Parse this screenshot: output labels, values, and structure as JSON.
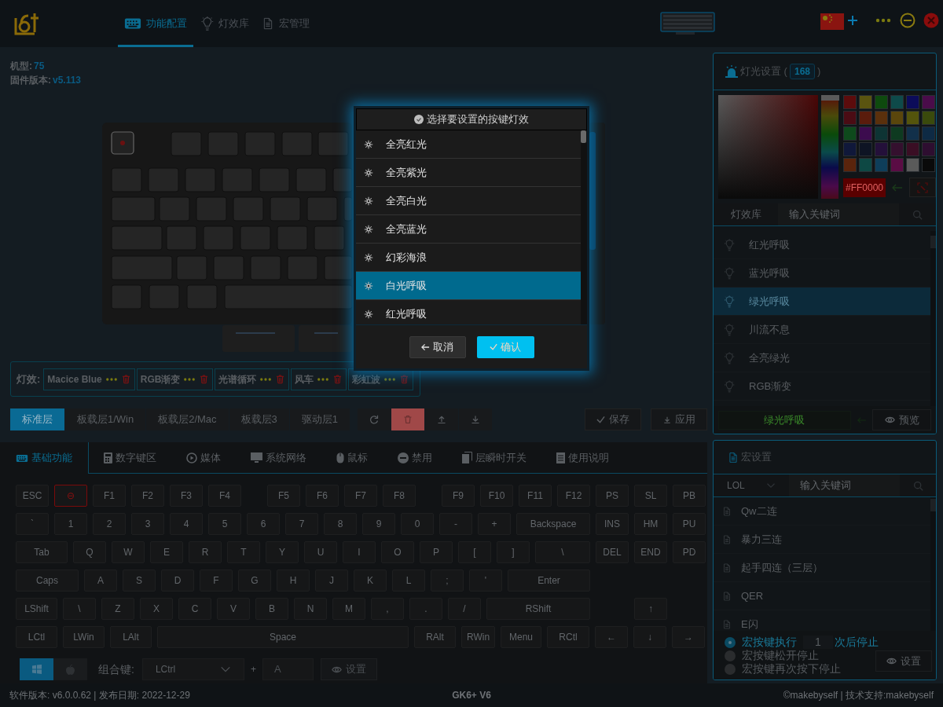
{
  "nav_tabs": [
    {
      "label": "功能配置",
      "selected": true
    },
    {
      "label": "灯效库",
      "selected": false
    },
    {
      "label": "宏管理",
      "selected": false
    }
  ],
  "device_info": [
    {
      "label": "机型:",
      "value": "75"
    },
    {
      "label": "固件版本:",
      "value": "v5.113"
    }
  ],
  "effects_bar": {
    "label": "灯效:",
    "effects": [
      "Macice Blue",
      "RGB渐变",
      "光谱循环",
      "风车",
      "彩虹波"
    ]
  },
  "layers": [
    {
      "label": "标准层",
      "selected": true
    },
    {
      "label": "板载层1/Win",
      "selected": false
    },
    {
      "label": "板载层2/Mac",
      "selected": false
    },
    {
      "label": "板载层3",
      "selected": false
    },
    {
      "label": "驱动层1",
      "selected": false
    }
  ],
  "save_button": "保存",
  "apply_button": "应用",
  "key_tabs": [
    {
      "label": "基础功能",
      "selected": true
    },
    {
      "label": "数字键区",
      "selected": false
    },
    {
      "label": "媒体",
      "selected": false
    },
    {
      "label": "系统网络",
      "selected": false
    },
    {
      "label": "鼠标",
      "selected": false
    },
    {
      "label": "禁用",
      "selected": false
    },
    {
      "label": "层瞬时开关",
      "selected": false
    },
    {
      "label": "使用说明",
      "selected": false
    }
  ],
  "keys": [
    [
      {
        "label": "ESC",
        "selected": false
      },
      {
        "label": "⊖",
        "selected": true
      },
      {
        "label": "F1",
        "selected": false
      },
      {
        "label": "F2",
        "selected": false
      },
      {
        "label": "F3",
        "selected": false
      },
      {
        "label": "F4",
        "selected": false
      },
      {
        "label": "F5",
        "selected": false
      },
      {
        "label": "F6",
        "selected": false
      },
      {
        "label": "F7",
        "selected": false
      },
      {
        "label": "F8",
        "selected": false
      },
      {
        "label": "F9",
        "selected": false
      },
      {
        "label": "F10",
        "selected": false
      },
      {
        "label": "F11",
        "selected": false
      },
      {
        "label": "F12",
        "selected": false
      },
      {
        "label": "PS",
        "selected": false
      },
      {
        "label": "SL",
        "selected": false
      },
      {
        "label": "PB",
        "selected": false
      }
    ],
    [
      {
        "label": "`",
        "selected": false
      },
      {
        "label": "1",
        "selected": false
      },
      {
        "label": "2",
        "selected": false
      },
      {
        "label": "3",
        "selected": false
      },
      {
        "label": "4",
        "selected": false
      },
      {
        "label": "5",
        "selected": false
      },
      {
        "label": "6",
        "selected": false
      },
      {
        "label": "7",
        "selected": false
      },
      {
        "label": "8",
        "selected": false
      },
      {
        "label": "9",
        "selected": false
      },
      {
        "label": "0",
        "selected": false
      },
      {
        "label": "-",
        "selected": false
      },
      {
        "label": "+",
        "selected": false
      },
      {
        "label": "Backspace",
        "selected": false
      },
      {
        "label": "INS",
        "selected": false
      },
      {
        "label": "HM",
        "selected": false
      },
      {
        "label": "PU",
        "selected": false
      }
    ],
    [
      {
        "label": "Tab",
        "selected": false
      },
      {
        "label": "Q",
        "selected": false
      },
      {
        "label": "W",
        "selected": false
      },
      {
        "label": "E",
        "selected": false
      },
      {
        "label": "R",
        "selected": false
      },
      {
        "label": "T",
        "selected": false
      },
      {
        "label": "Y",
        "selected": false
      },
      {
        "label": "U",
        "selected": false
      },
      {
        "label": "I",
        "selected": false
      },
      {
        "label": "O",
        "selected": false
      },
      {
        "label": "P",
        "selected": false
      },
      {
        "label": "[",
        "selected": false
      },
      {
        "label": "]",
        "selected": false
      },
      {
        "label": "\\",
        "selected": false
      },
      {
        "label": "DEL",
        "selected": false
      },
      {
        "label": "END",
        "selected": false
      },
      {
        "label": "PD",
        "selected": false
      }
    ],
    [
      {
        "label": "Caps",
        "selected": false
      },
      {
        "label": "A",
        "selected": false
      },
      {
        "label": "S",
        "selected": false
      },
      {
        "label": "D",
        "selected": false
      },
      {
        "label": "F",
        "selected": false
      },
      {
        "label": "G",
        "selected": false
      },
      {
        "label": "H",
        "selected": false
      },
      {
        "label": "J",
        "selected": false
      },
      {
        "label": "K",
        "selected": false
      },
      {
        "label": "L",
        "selected": false
      },
      {
        "label": ";",
        "selected": false
      },
      {
        "label": "'",
        "selected": false
      },
      {
        "label": "Enter",
        "selected": false
      }
    ],
    [
      {
        "label": "LShift",
        "selected": false
      },
      {
        "label": "\\",
        "selected": false
      },
      {
        "label": "Z",
        "selected": false
      },
      {
        "label": "X",
        "selected": false
      },
      {
        "label": "C",
        "selected": false
      },
      {
        "label": "V",
        "selected": false
      },
      {
        "label": "B",
        "selected": false
      },
      {
        "label": "N",
        "selected": false
      },
      {
        "label": "M",
        "selected": false
      },
      {
        "label": ",",
        "selected": false
      },
      {
        "label": ".",
        "selected": false
      },
      {
        "label": "/",
        "selected": false
      },
      {
        "label": "RShift",
        "selected": false
      },
      {
        "label": "↑",
        "selected": false
      }
    ],
    [
      {
        "label": "LCtl",
        "selected": false
      },
      {
        "label": "LWin",
        "selected": false
      },
      {
        "label": "LAlt",
        "selected": false
      },
      {
        "label": "Space",
        "selected": false
      },
      {
        "label": "RAlt",
        "selected": false
      },
      {
        "label": "RWin",
        "selected": false
      },
      {
        "label": "Menu",
        "selected": false
      },
      {
        "label": "RCtl",
        "selected": false
      },
      {
        "label": "←",
        "selected": false
      },
      {
        "label": "↓",
        "selected": false
      },
      {
        "label": "→",
        "selected": false
      }
    ]
  ],
  "os_buttons": [
    {
      "kind": "windows",
      "selected": true
    },
    {
      "kind": "apple",
      "selected": false
    }
  ],
  "combo": {
    "label": "组合键:",
    "modifier": "LCtrl",
    "plus": "+",
    "key": "A",
    "button": "设置"
  },
  "footer": {
    "software": "软件版本: v6.0.0.62 | 发布日期: 2022-12-29",
    "model": "GK6+ V6",
    "credits": "©makebyself | 技术支持:makebyself"
  },
  "light_settings": {
    "title": "灯光设置 (",
    "count": "168",
    "title_end": ")",
    "swatches": [
      {
        "color": "#5c0c0c"
      },
      {
        "color": "#5a5410"
      },
      {
        "color": "#0e4a0e"
      },
      {
        "color": "#0e4a4a"
      },
      {
        "color": "#0c0c5a"
      },
      {
        "color": "#4a0c4a"
      },
      {
        "color": "#4a0c14"
      },
      {
        "color": "#5a1c0c"
      },
      {
        "color": "#5a300c"
      },
      {
        "color": "#5a460c"
      },
      {
        "color": "#54540c"
      },
      {
        "color": "#3a4a0c"
      },
      {
        "color": "#0e4a1c"
      },
      {
        "color": "#3c0c4e"
      },
      {
        "color": "#0e3434"
      },
      {
        "color": "#0e3a20"
      },
      {
        "color": "#12304a"
      },
      {
        "color": "#0e2a44"
      },
      {
        "color": "#10183a"
      },
      {
        "color": "#0e1424"
      },
      {
        "color": "#24103a"
      },
      {
        "color": "#34102e"
      },
      {
        "color": "#3a0e24"
      },
      {
        "color": "#2e0e30"
      },
      {
        "color": "#5a240c"
      },
      {
        "color": "#0e4844"
      },
      {
        "color": "#0e3e5a"
      },
      {
        "color": "#5a0c44"
      },
      {
        "color": "#5a5a5a"
      },
      {
        "color": "#0a0a0a"
      }
    ],
    "hue_slider": {
      "level": 0
    },
    "hex": "#FF0000",
    "library_label": "灯效库",
    "search_placeholder": "输入关键词",
    "effects": [
      {
        "name": "红光呼吸",
        "selected": false
      },
      {
        "name": "蓝光呼吸",
        "selected": false
      },
      {
        "name": "绿光呼吸",
        "selected": true
      },
      {
        "name": "川流不息",
        "selected": false
      },
      {
        "name": "全亮绿光",
        "selected": false
      },
      {
        "name": "RGB渐变",
        "selected": false
      }
    ],
    "current_effect": "绿光呼吸",
    "preview_button": "预览"
  },
  "macro_settings": {
    "title": "宏设置",
    "group": "LOL",
    "search_placeholder": "输入关键词",
    "macros": [
      "Qw二连",
      "暴力三连",
      "起手四连（三层）",
      "QER",
      "E闪"
    ],
    "stop_modes": [
      {
        "kind": "count",
        "before": "宏按键执行",
        "count": "1",
        "after": "次后停止",
        "selected": true
      },
      {
        "kind": "plain",
        "label": "宏按键松开停止",
        "selected": false
      },
      {
        "kind": "plain",
        "label": "宏按键再次按下停止",
        "selected": false
      }
    ],
    "settings_button": "设置"
  },
  "dialog": {
    "title": "选择要设置的按键灯效",
    "effects": [
      {
        "name": "全亮红光",
        "selected": false
      },
      {
        "name": "全亮紫光",
        "selected": false
      },
      {
        "name": "全亮白光",
        "selected": false
      },
      {
        "name": "全亮蓝光",
        "selected": false
      },
      {
        "name": "幻彩海浪",
        "selected": false
      },
      {
        "name": "白光呼吸",
        "selected": true
      },
      {
        "name": "红光呼吸",
        "selected": false
      }
    ],
    "cancel": "取消",
    "confirm": "确认"
  }
}
